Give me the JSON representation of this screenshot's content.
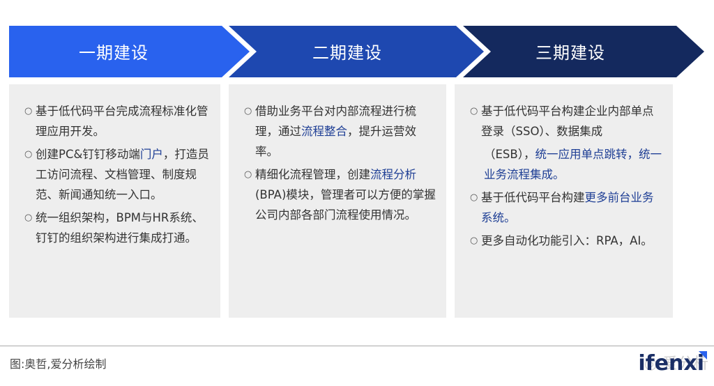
{
  "colors": {
    "phase1": "#2962ee",
    "phase2": "#1e48b0",
    "phase3": "#14295e",
    "panel": "#eeeeee",
    "highlight": "#1f3f95"
  },
  "phases": [
    {
      "title": "一期建设"
    },
    {
      "title": "二期建设"
    },
    {
      "title": "三期建设"
    }
  ],
  "columns": [
    {
      "bullets": [
        {
          "segments": [
            {
              "t": "基于低代码平台完成流程标准化管理应用开发。",
              "h": false
            }
          ]
        },
        {
          "segments": [
            {
              "t": "创建PC&钉钉移动端",
              "h": false
            },
            {
              "t": "门户",
              "h": true
            },
            {
              "t": "，打造员工访问流程、文档管理、制度规范、新闻通知统一入口。",
              "h": false
            }
          ]
        },
        {
          "segments": [
            {
              "t": "统一组织架构，BPM与HR系统、钉钉的组织架构进行集成打通。",
              "h": false
            }
          ]
        }
      ]
    },
    {
      "bullets": [
        {
          "segments": [
            {
              "t": "借助业务平台对内部流程进行梳理，通过",
              "h": false
            },
            {
              "t": "流程整合",
              "h": true
            },
            {
              "t": "，提升运营效率。",
              "h": false
            }
          ]
        },
        {
          "segments": [
            {
              "t": "精细化流程管理，创建",
              "h": false
            },
            {
              "t": "流程分析",
              "h": true
            },
            {
              "t": "(BPA)模块，管理者可以方便的掌握公司内部各部门流程使用情况。",
              "h": false
            }
          ]
        }
      ]
    },
    {
      "bullets": [
        {
          "segments": [
            {
              "t": "基于低代码平台构建企业内部单点登录（SSO）、数据集成",
              "h": false
            }
          ],
          "extra": [
            {
              "t": "（ESB），",
              "h": false
            },
            {
              "t": "统一应用单点跳转，统一业务流程集成。",
              "h": true
            }
          ]
        },
        {
          "segments": [
            {
              "t": "基于低代码平台构建",
              "h": false
            },
            {
              "t": "更多前台业务系统。",
              "h": true
            }
          ]
        },
        {
          "segments": [
            {
              "t": "更多自动化功能引入：RPA，AI。",
              "h": false
            }
          ]
        }
      ]
    }
  ],
  "footer": {
    "source": "图:奥哲,爱分析绘制",
    "watermark": "爱分析",
    "logo": "ifenxi"
  }
}
